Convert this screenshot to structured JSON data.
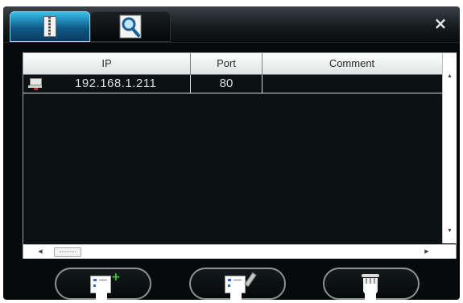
{
  "window": {
    "close_label": "×"
  },
  "tabs": [
    {
      "name": "address-book",
      "icon": "address-book-icon",
      "active": true
    },
    {
      "name": "search",
      "icon": "search-icon",
      "active": false
    }
  ],
  "table": {
    "columns": [
      "IP",
      "Port",
      "Comment"
    ],
    "rows": [
      {
        "icon": "computer-icon",
        "ip": "192.168.1.211",
        "port": "80",
        "comment": ""
      }
    ]
  },
  "scrollbars": {
    "up_arrow": "▲",
    "down_arrow": "▼",
    "left_arrow": "◀",
    "right_arrow": "▶"
  },
  "buttons": [
    {
      "name": "add-device",
      "icon": "add-card-icon",
      "plus": "+"
    },
    {
      "name": "edit-device",
      "icon": "edit-card-icon"
    },
    {
      "name": "delete-device",
      "icon": "trash-icon"
    }
  ],
  "colors": {
    "background": "#060a0a",
    "active_tab": "#1a8cc4",
    "text": "#d9dede",
    "add_plus": "#2fd63a"
  }
}
